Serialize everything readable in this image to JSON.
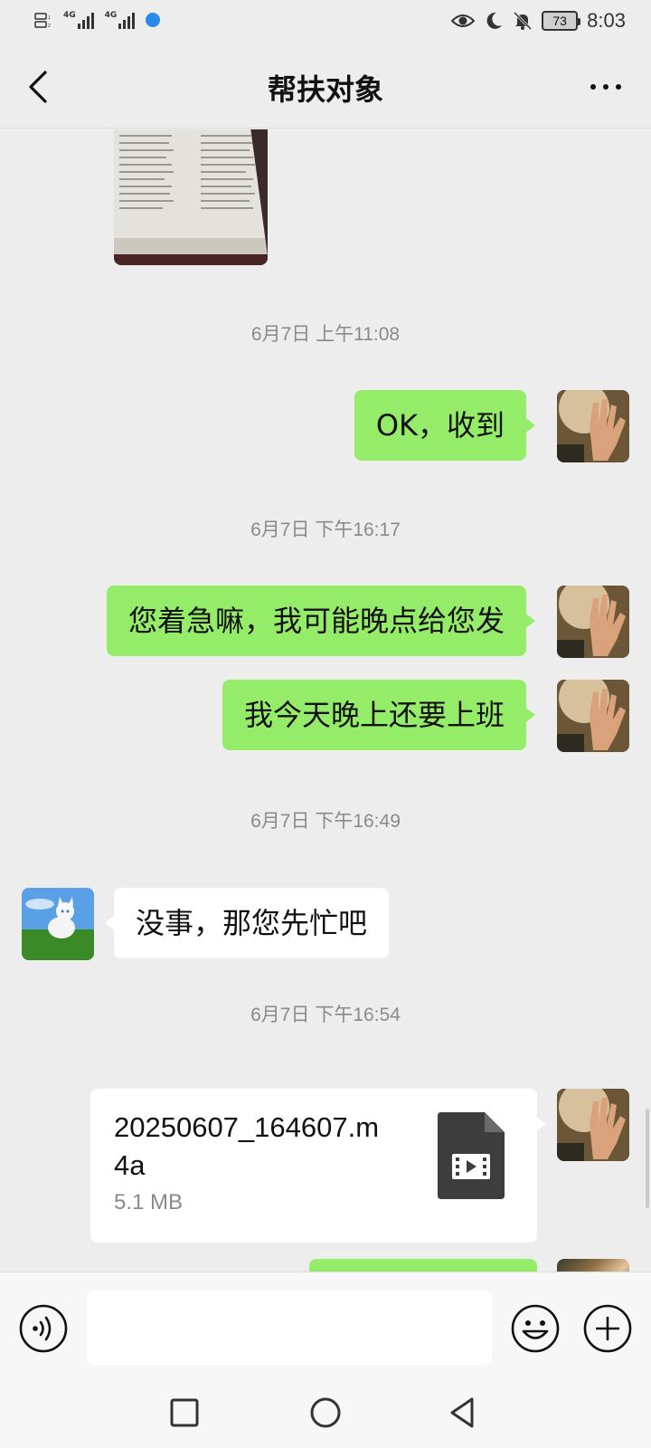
{
  "status_bar": {
    "network_left": "4G",
    "network_right": "4G",
    "battery": "73",
    "time": "8:03",
    "icons": [
      "sim-icon",
      "signal-icon",
      "signal-icon",
      "app-notification-icon",
      "eye-icon",
      "moon-icon",
      "mute-bell-icon",
      "battery-icon"
    ]
  },
  "header": {
    "title": "帮扶对象",
    "back_icon": "chevron-left-icon",
    "more_icon": "more-dots-icon"
  },
  "messages": [
    {
      "type": "image",
      "sender": "other",
      "desc_icon": "document-photo"
    },
    {
      "type": "timestamp",
      "text": "6月7日 上午11:08"
    },
    {
      "type": "text",
      "sender": "self",
      "text": "OK，收到"
    },
    {
      "type": "timestamp",
      "text": "6月7日 下午16:17"
    },
    {
      "type": "text",
      "sender": "self",
      "text": "您着急嘛，我可能晚点给您发"
    },
    {
      "type": "text",
      "sender": "self",
      "text": "我今天晚上还要上班"
    },
    {
      "type": "timestamp",
      "text": "6月7日 下午16:49"
    },
    {
      "type": "text",
      "sender": "other",
      "text": "没事，那您先忙吧"
    },
    {
      "type": "timestamp",
      "text": "6月7日 下午16:54"
    },
    {
      "type": "file",
      "sender": "self",
      "file_name": "20250607_164607.m4a",
      "file_size": "5.1 MB",
      "icon": "video-file-icon"
    }
  ],
  "input_bar": {
    "voice_icon": "voice-icon",
    "input_value": "",
    "emoji_icon": "emoji-icon",
    "plus_icon": "plus-circle-icon"
  },
  "nav_bar": {
    "icons": [
      "recents-square-icon",
      "home-circle-icon",
      "back-triangle-icon"
    ]
  },
  "colors": {
    "self_bubble": "#95ec69",
    "other_bubble": "#ffffff",
    "background": "#ededed",
    "timestamp_text": "#8a8a8a"
  }
}
